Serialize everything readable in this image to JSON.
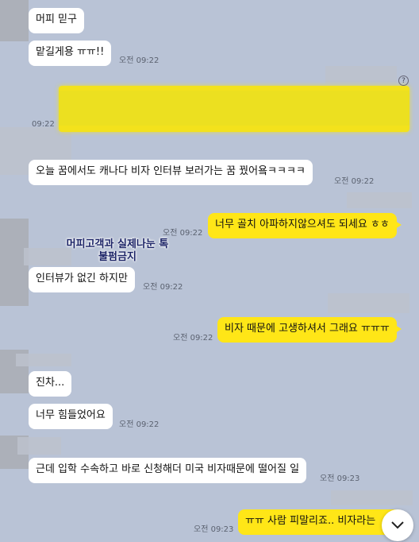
{
  "messages": [
    {
      "id": "m1",
      "text": "머피 믿구",
      "time": ""
    },
    {
      "id": "m2",
      "text": "맡길게용 ㅠㅠ!!",
      "time": "오전 09:22"
    },
    {
      "id": "m3",
      "text": "",
      "time": "09:22"
    },
    {
      "id": "m4",
      "text": "오늘 꿈에서도 캐나다 비자 인터뷰 보러가는 꿈 꿨어욬ㅋㅋㅋㅋ",
      "time": "오전 09:22"
    },
    {
      "id": "m5",
      "text": "너무 골치 아파하지않으셔도 되세요 ㅎㅎ",
      "time": "오전 09:22"
    },
    {
      "id": "m6",
      "text": "인터뷰가 없긴 하지만",
      "time": "오전 09:22"
    },
    {
      "id": "m7",
      "text": "비자 때문에 고생하셔서 그래요 ㅠㅠㅠ",
      "time": "오전 09:22"
    },
    {
      "id": "m8",
      "text": "진차...",
      "time": ""
    },
    {
      "id": "m9",
      "text": "너무 힘들었어요",
      "time": "오전 09:22"
    },
    {
      "id": "m10",
      "text": "근데 입학 수속하고 바로 신청해더 미국 비자때문에 떨어질 일",
      "time": "오전 09:23"
    },
    {
      "id": "m11",
      "text": "ㅠㅠ 사람 피말리죠.. 비자라는",
      "time": "오전 09:23"
    }
  ],
  "watermark": {
    "line1": "머피고객과 실제나눈 톡",
    "line2": "불펌금지"
  },
  "icons": {
    "help": "question-circle-icon",
    "scroll_down": "chevron-down-icon"
  },
  "colors": {
    "background": "#b9c3d6",
    "incoming_bubble": "#ffffff",
    "outgoing_bubble": "#ffe617",
    "watermark": "#1b2366"
  }
}
